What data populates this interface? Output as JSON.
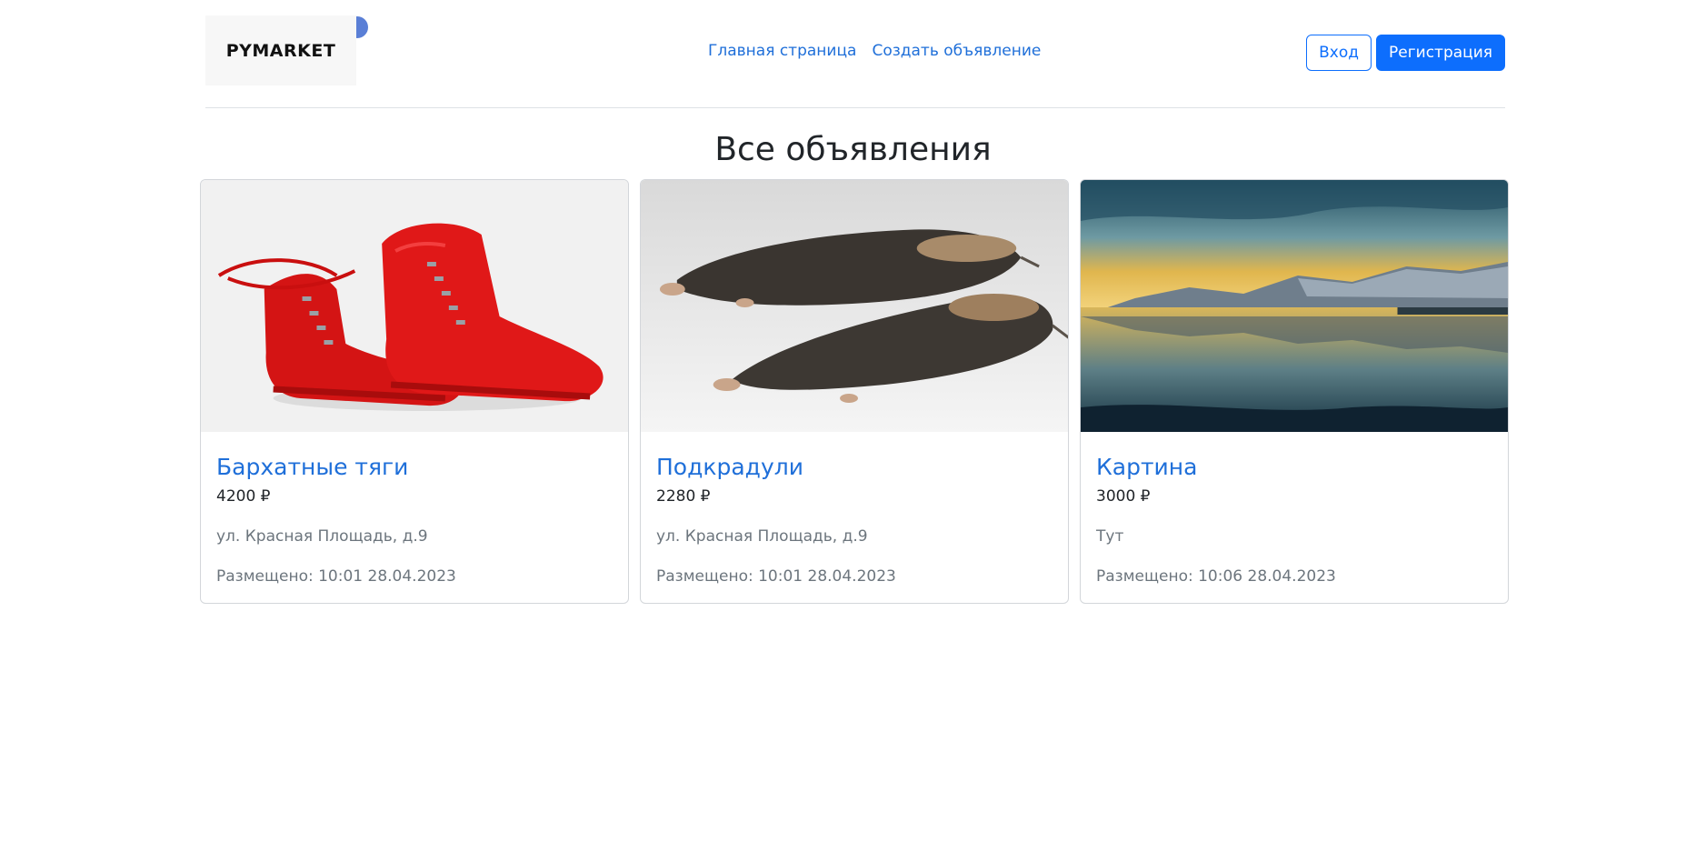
{
  "brand": {
    "logo_text": "PYMARKET"
  },
  "nav": {
    "home": "Главная страница",
    "create": "Создать объявление"
  },
  "auth": {
    "login": "Вход",
    "register": "Регистрация"
  },
  "page": {
    "title": "Все объявления"
  },
  "listings": [
    {
      "title": "Бархатные тяги",
      "price": "4200 ₽",
      "address": "ул. Красная Площадь, д.9",
      "posted": "Размещено: 10:01 28.04.2023"
    },
    {
      "title": "Подкрадули",
      "price": "2280 ₽",
      "address": "ул. Красная Площадь, д.9",
      "posted": "Размещено: 10:01 28.04.2023"
    },
    {
      "title": "Картина",
      "price": "3000 ₽",
      "address": "Тут",
      "posted": "Размещено: 10:06 28.04.2023"
    }
  ],
  "colors": {
    "accent": "#0d6efd",
    "link": "#1f6fd9",
    "muted": "#6c757d"
  }
}
